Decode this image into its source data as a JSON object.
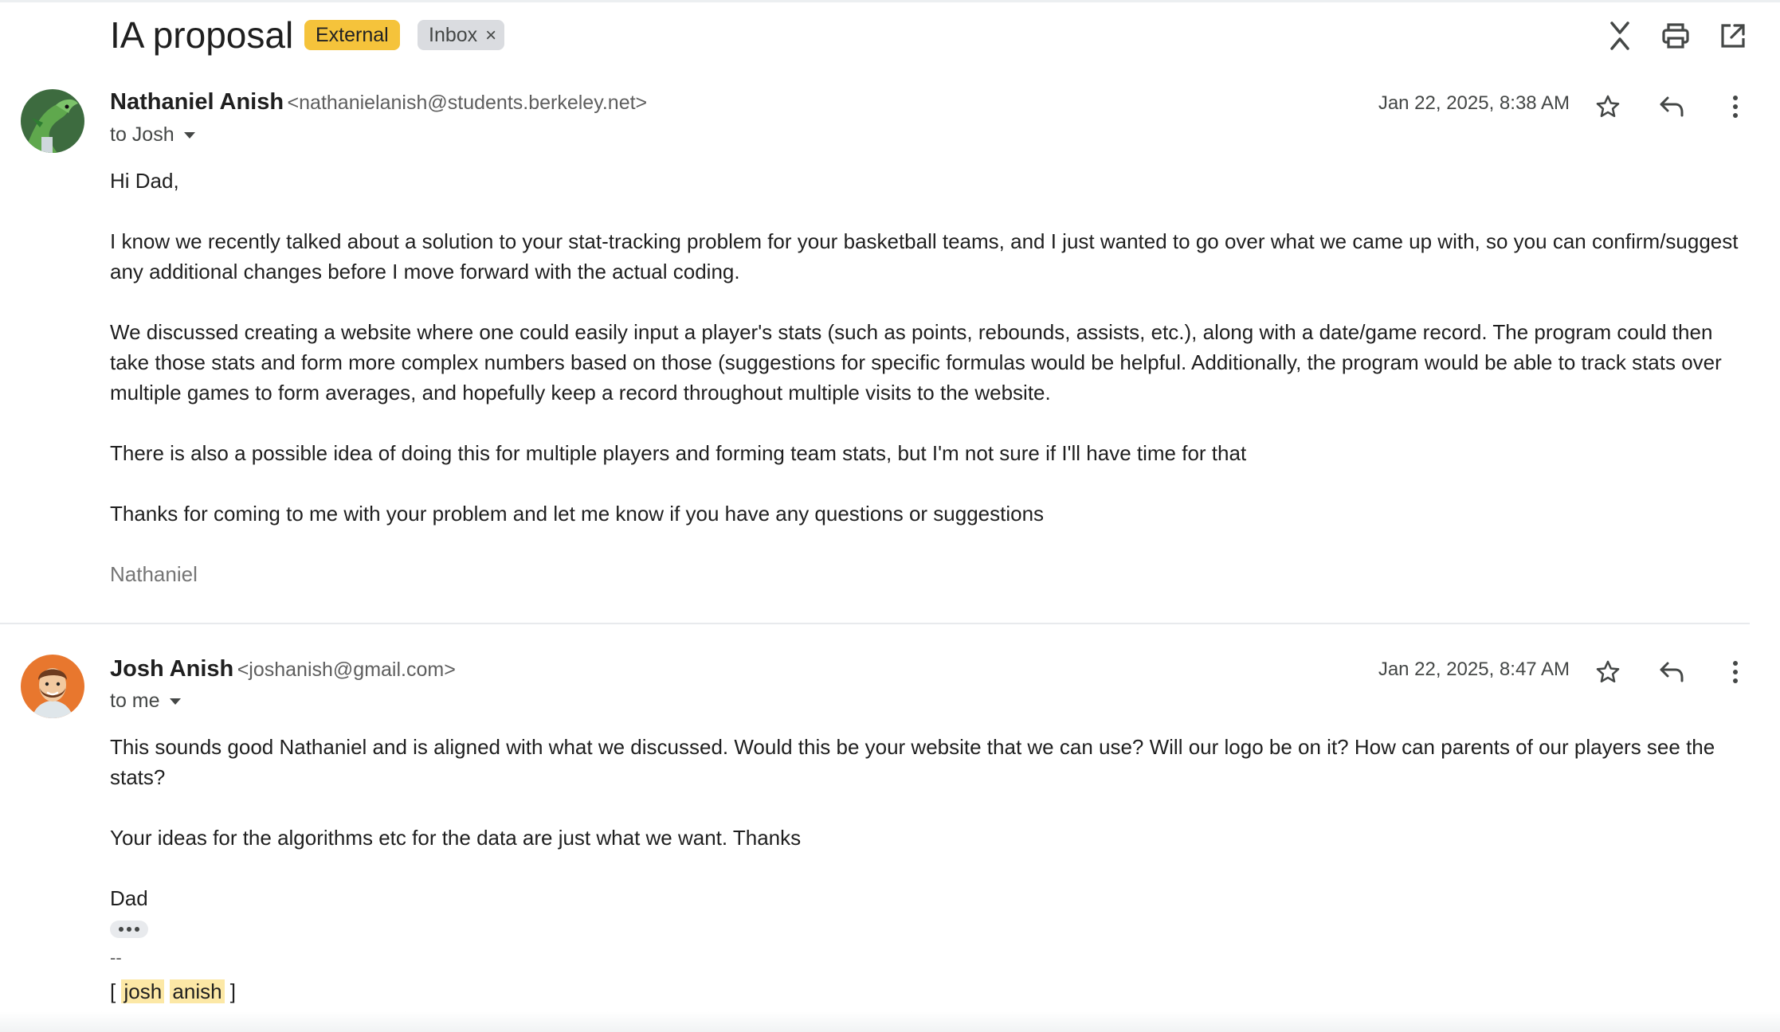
{
  "thread": {
    "subject": "IA proposal",
    "labels": {
      "external": "External",
      "inbox": "Inbox",
      "inbox_remove": "×"
    },
    "colors": {
      "external_chip": "#f5c33b",
      "inbox_chip": "#dadce0"
    }
  },
  "toolbar": {
    "collapse_icon": "collapse-all-icon",
    "print_icon": "print-icon",
    "open_new_window_icon": "open-in-new-window-icon"
  },
  "messages": [
    {
      "sender_name": "Nathaniel Anish",
      "sender_email": "<nathanielanish@students.berkeley.net>",
      "recipient": "to Josh",
      "date": "Jan 22, 2025, 8:38 AM",
      "avatar": "dragon-avatar",
      "body": [
        "Hi Dad,",
        "I know we recently talked about a solution to your stat-tracking problem for your basketball teams, and I just wanted to go over what we came up with, so you can confirm/suggest any additional changes before I move forward with the actual coding.",
        "We discussed creating a website where one could easily input a player's stats (such as points, rebounds, assists, etc.), along with a date/game record. The program could then take those stats and form more complex numbers based on those (suggestions for specific formulas would be helpful. Additionally, the program would be able to track stats over multiple games to form averages, and hopefully keep a record throughout multiple visits to the website.",
        "There is also a possible idea of doing this for multiple players and forming team stats, but I'm not sure if I'll have time for that",
        "Thanks for coming to me with your problem and let me know if you have any questions or suggestions"
      ],
      "signature": "Nathaniel"
    },
    {
      "sender_name": "Josh Anish",
      "sender_email": "<joshanish@gmail.com>",
      "recipient": "to me",
      "date": "Jan 22, 2025, 8:47 AM",
      "avatar": "cartoon-face-avatar",
      "body": [
        "This sounds good Nathaniel and is aligned with what we discussed. Would this be your website that we can use? Will our logo be on it? How can parents of our players see the stats?",
        "Your ideas for the algorithms etc for the data are just what we want. Thanks",
        "Dad"
      ],
      "sig_separator": "--",
      "sig_bracket_open": "[",
      "sig_word1": "josh",
      "sig_word2": "anish",
      "sig_bracket_close": "]"
    }
  ]
}
